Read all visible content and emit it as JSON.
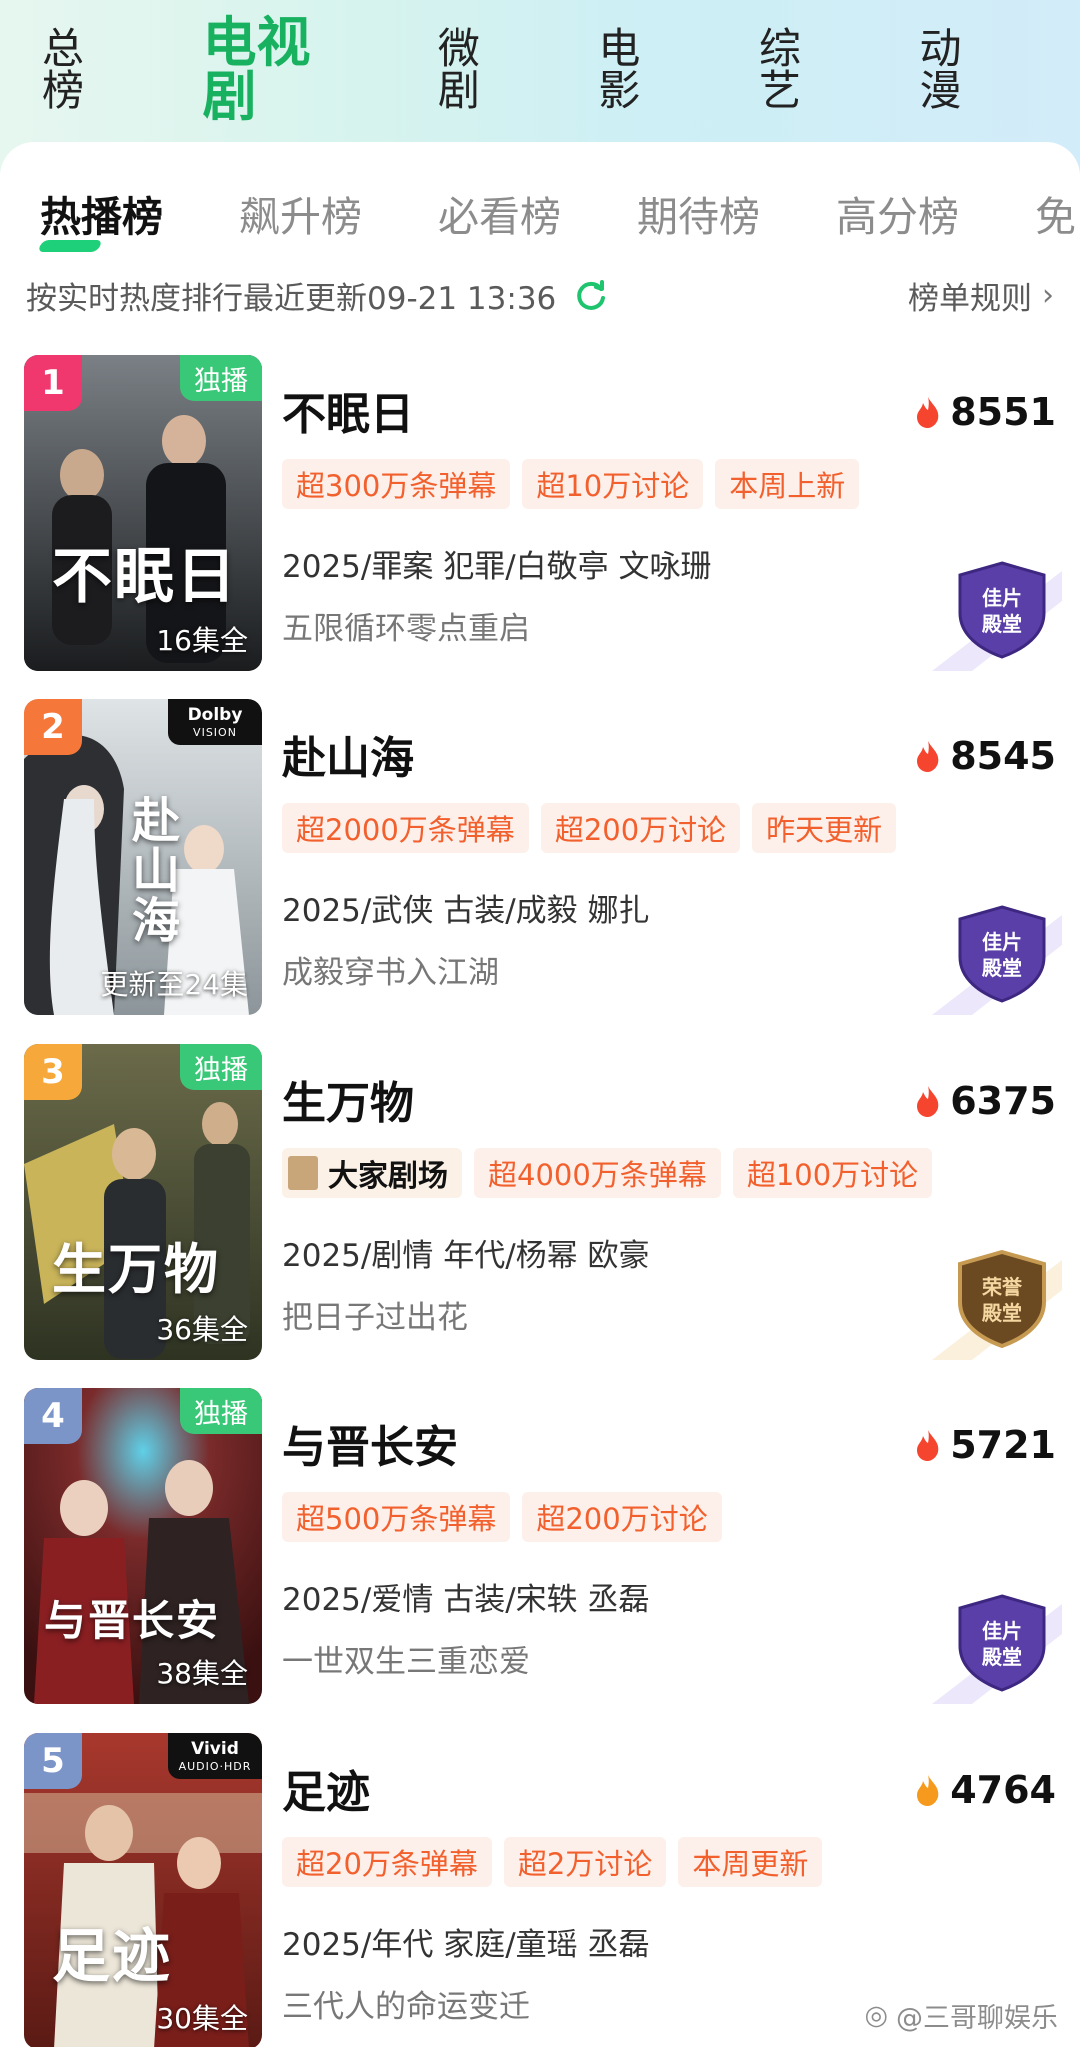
{
  "top_tabs": [
    "总榜",
    "电视剧",
    "微剧",
    "电影",
    "综艺",
    "动漫"
  ],
  "sub_tabs": [
    "热播榜",
    "飙升榜",
    "必看榜",
    "期待榜",
    "高分榜",
    "免"
  ],
  "update_text": "按实时热度排行最近更新09-21 13:36",
  "rules_label": "榜单规则",
  "items": [
    {
      "rank": "1",
      "badge": "独播",
      "poster_title": "不眠日",
      "episodes": "16集全",
      "title": "不眠日",
      "heat": "8551",
      "tags": [
        "超300万条弹幕",
        "超10万讨论",
        "本周上新"
      ],
      "meta": "2025/罪案 犯罪/白敬亭 文咏珊",
      "slogan": "五限循环零点重启",
      "hall_line1": "佳片",
      "hall_line2": "殿堂"
    },
    {
      "rank": "2",
      "badge": "Dolby",
      "badge_sub": "VISION",
      "poster_title": "赴山海",
      "episodes": "更新至24集",
      "title": "赴山海",
      "heat": "8545",
      "tags": [
        "超2000万条弹幕",
        "超200万讨论",
        "昨天更新"
      ],
      "meta": "2025/武侠 古装/成毅 娜扎",
      "slogan": "成毅穿书入江湖",
      "hall_line1": "佳片",
      "hall_line2": "殿堂"
    },
    {
      "rank": "3",
      "badge": "独播",
      "poster_title": "生万物",
      "episodes": "36集全",
      "title": "生万物",
      "heat": "6375",
      "theater": "大家剧场",
      "tags": [
        "超4000万条弹幕",
        "超100万讨论"
      ],
      "meta": "2025/剧情 年代/杨幂 欧豪",
      "slogan": "把日子过出花",
      "hall_line1": "荣誉",
      "hall_line2": "殿堂"
    },
    {
      "rank": "4",
      "badge": "独播",
      "poster_title": "与晋长安",
      "episodes": "38集全",
      "title": "与晋长安",
      "heat": "5721",
      "tags": [
        "超500万条弹幕",
        "超200万讨论"
      ],
      "meta": "2025/爱情 古装/宋轶 丞磊",
      "slogan": "一世双生三重恋爱",
      "hall_line1": "佳片",
      "hall_line2": "殿堂"
    },
    {
      "rank": "5",
      "badge": "Vivid",
      "badge_sub": "AUDIO·HDR",
      "poster_title": "足迹",
      "episodes": "30集全",
      "title": "足迹",
      "heat": "4764",
      "tags": [
        "超20万条弹幕",
        "超2万讨论",
        "本周更新"
      ],
      "meta": "2025/年代 家庭/童瑶 丞磊",
      "slogan": "三代人的命运变迁"
    }
  ],
  "watermark": "@三哥聊娱乐",
  "colors": {
    "accent_green": "#18b15f",
    "tag_orange": "#f2602e",
    "rank_1": "#f0386e",
    "rank_2": "#f5773a",
    "rank_3": "#f6a93a",
    "rank_other": "#7c95c9"
  }
}
